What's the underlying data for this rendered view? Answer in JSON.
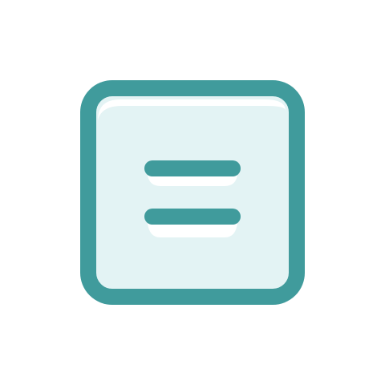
{
  "icon": {
    "name": "menu-icon",
    "shape": "rounded-square-with-two-horizontal-bars"
  },
  "colors": {
    "background": "#ffffff",
    "frame": "#409b9c",
    "fill": "#e3f3f4",
    "bar": "#409b9c",
    "highlight": "#ffffff"
  }
}
